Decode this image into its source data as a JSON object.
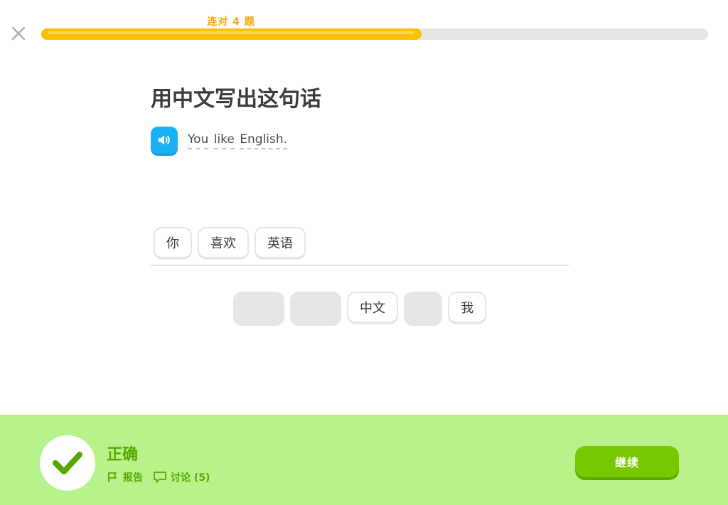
{
  "colors": {
    "progress_fill": "#fbc002",
    "streak_text": "#f5a800",
    "speaker_blue": "#1cb0f6",
    "feedback_bg": "#b8f28b",
    "feedback_green": "#58a700",
    "check_green": "#58a700",
    "continue_bg": "#78c800"
  },
  "header": {
    "close_icon": "close-icon",
    "streak_label": "连对 4 题",
    "progress": 0.57
  },
  "prompt": {
    "title": "用中文写出这句话",
    "speaker_icon": "speaker-icon",
    "sentence_words": [
      "You",
      "like",
      "English."
    ]
  },
  "answer": {
    "tiles": [
      "你",
      "喜欢",
      "英语"
    ]
  },
  "word_bank": {
    "tiles": [
      {
        "label": "",
        "used": true,
        "width": 72
      },
      {
        "label": "",
        "used": true,
        "width": 72
      },
      {
        "label": "中文",
        "used": false,
        "width": 72
      },
      {
        "label": "",
        "used": true,
        "width": 54
      },
      {
        "label": "我",
        "used": false,
        "width": 54
      }
    ]
  },
  "feedback": {
    "icon": "check-icon",
    "title": "正确",
    "report_icon": "flag-icon",
    "report_label": "报告",
    "discuss_icon": "comment-icon",
    "discuss_label": "讨论 (5)",
    "continue_label": "继续"
  }
}
